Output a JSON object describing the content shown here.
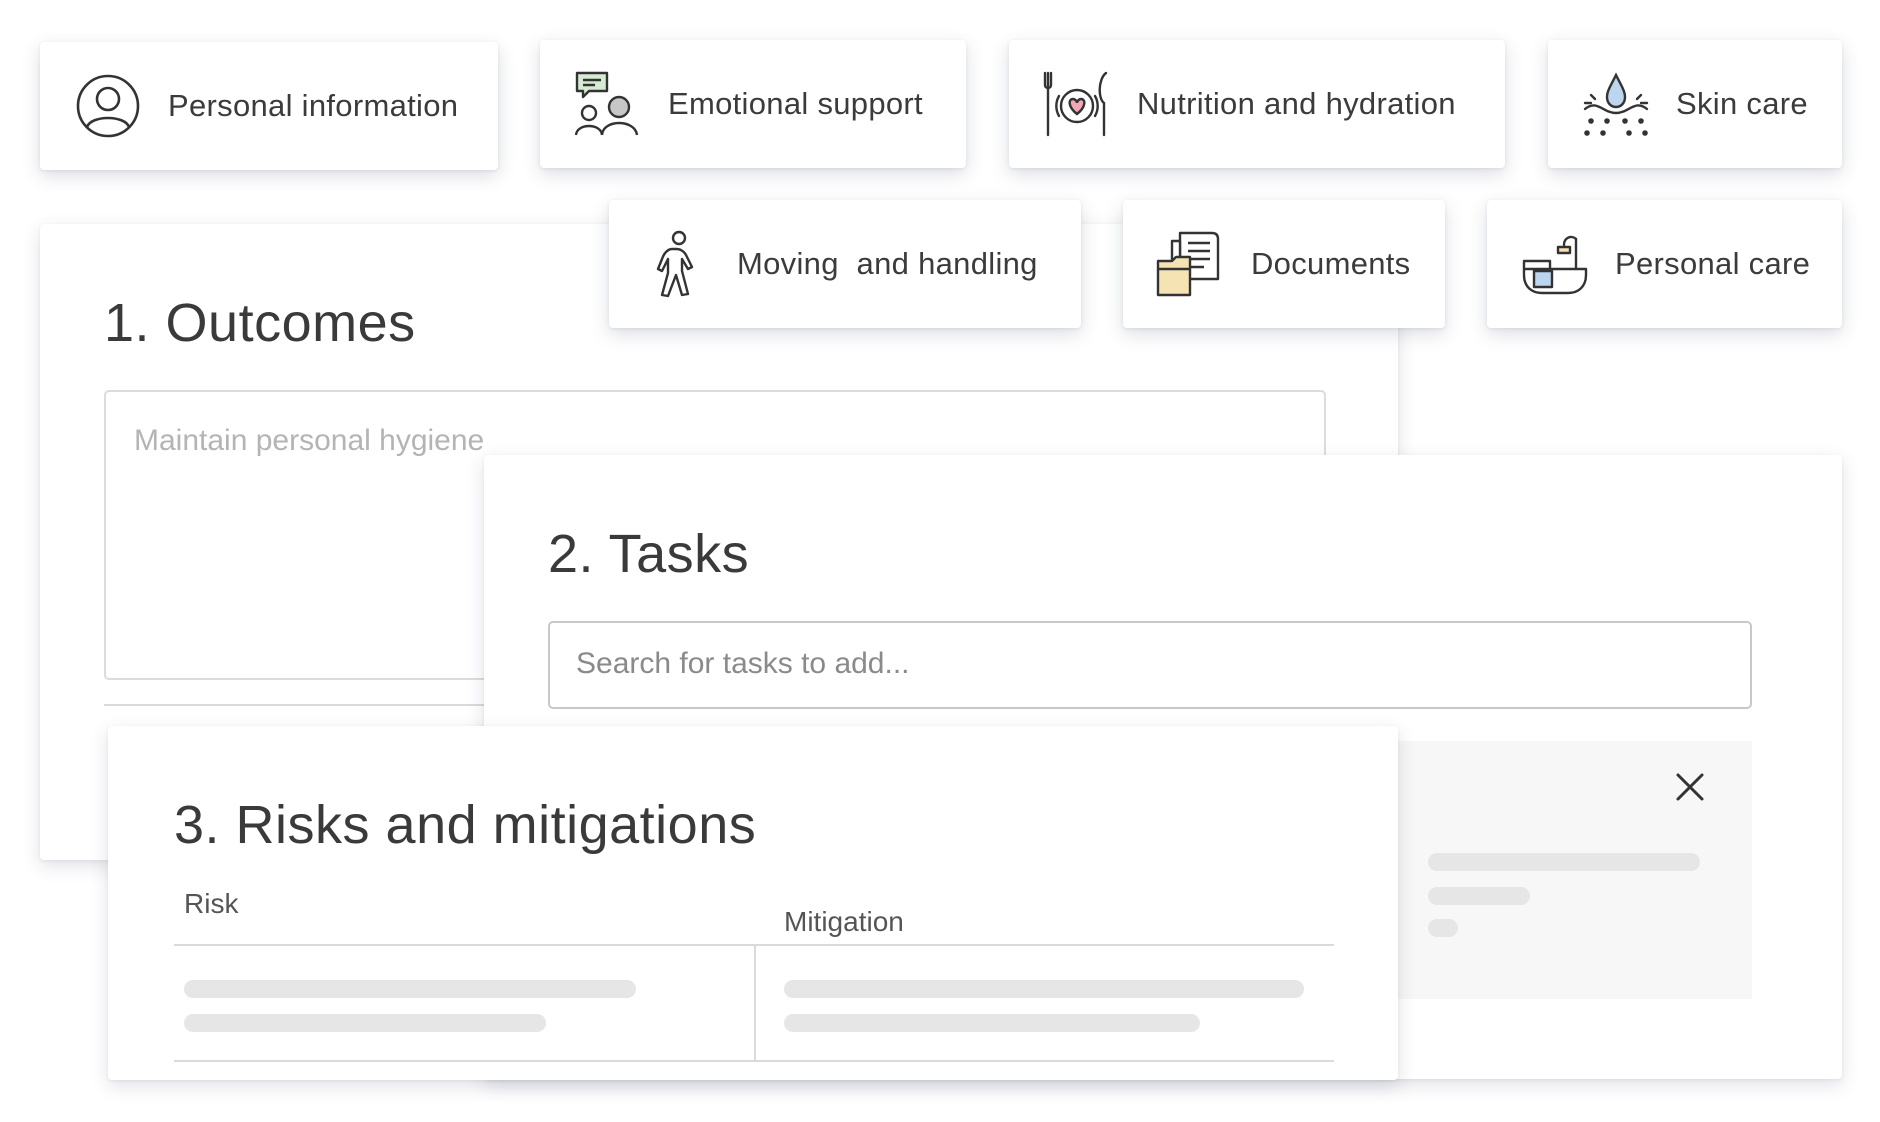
{
  "categories": [
    {
      "label": "Personal information",
      "icon": "person-circle-icon"
    },
    {
      "label": "Emotional support",
      "icon": "people-chat-icon"
    },
    {
      "label": "Nutrition and hydration",
      "icon": "plate-heart-cutlery-icon"
    },
    {
      "label": "Skin care",
      "icon": "water-drop-icon"
    },
    {
      "label": "Moving  and handling",
      "icon": "walking-person-icon"
    },
    {
      "label": "Documents",
      "icon": "folder-documents-icon"
    },
    {
      "label": "Personal care",
      "icon": "bathtub-icon"
    }
  ],
  "outcomes": {
    "title": "1. Outcomes",
    "placeholder": "Maintain personal hygiene"
  },
  "tasks": {
    "title": "2. Tasks",
    "search_placeholder": "Search for tasks to add..."
  },
  "risks": {
    "title": "3. Risks and mitigations",
    "col_risk": "Risk",
    "col_mitigation": "Mitigation"
  },
  "colors": {
    "text": "#3a3a3a",
    "placeholder": "#b4b4b4",
    "skeleton": "#e6e6e6",
    "icon_green": "#d6ecd2",
    "icon_pink": "#f3a6b5",
    "icon_yellow": "#f5e3b3",
    "icon_blue": "#bcd6ef"
  }
}
